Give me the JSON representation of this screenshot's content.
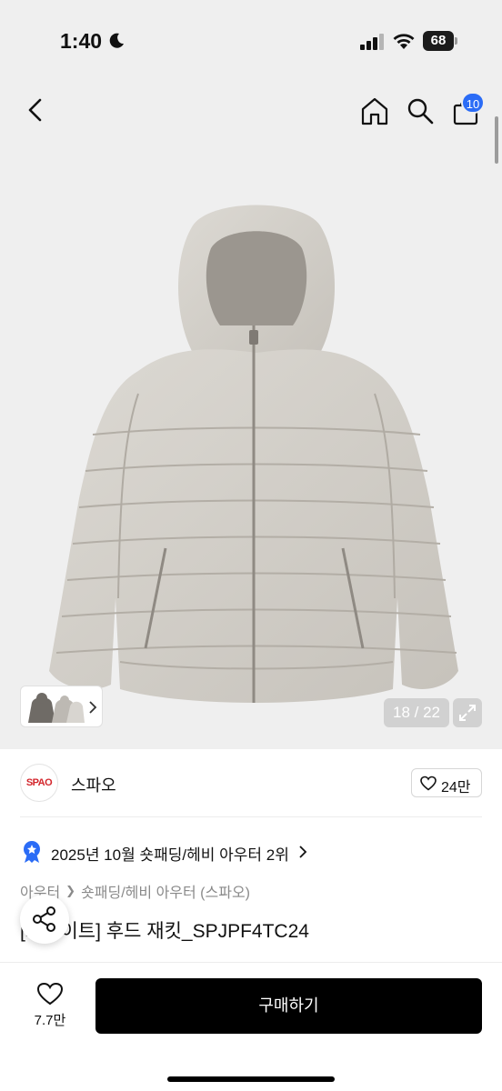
{
  "status_bar": {
    "time": "1:40",
    "battery": "68"
  },
  "nav": {
    "cart_count": "10"
  },
  "gallery": {
    "counter": "18 / 22"
  },
  "brand": {
    "logo_text": "SPAO",
    "name": "스파오",
    "like_count": "24만"
  },
  "ranking": {
    "text": "2025년 10월 숏패딩/헤비 아우터 2위"
  },
  "breadcrumb": {
    "items": [
      "아우터",
      "숏패딩/헤비 아우터 (스파오)"
    ]
  },
  "product": {
    "title": "[스파이트] 후드 재킷_SPJPF4TC24"
  },
  "bottom_bar": {
    "wish_count": "7.7만",
    "buy_label": "구매하기"
  },
  "colors": {
    "accent": "#2b6cf6",
    "brand_logo": "#d3262c",
    "buy_button": "#000000"
  }
}
